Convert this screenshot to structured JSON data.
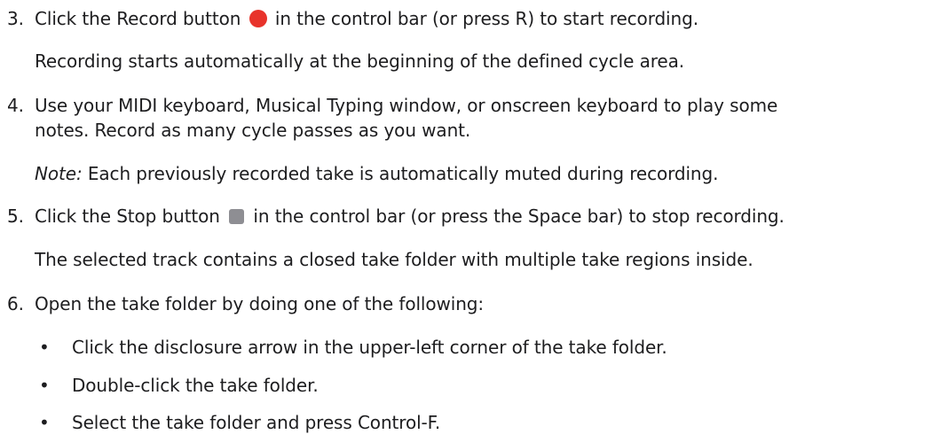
{
  "steps": [
    {
      "number": "3.",
      "text_before": "Click the Record button",
      "text_after": "in the control bar (or press R) to start recording.",
      "icon": "record-button-icon",
      "followup": "Recording starts automatically at the beginning of the defined cycle area."
    },
    {
      "number": "4.",
      "line1": "Use your MIDI keyboard, Musical Typing window, or onscreen keyboard to play some",
      "line2": "notes. Record as many cycle passes as you want.",
      "note_label": "Note:",
      "note_text": "Each previously recorded take is automatically muted during recording."
    },
    {
      "number": "5.",
      "text_before": "Click the Stop button",
      "text_after": "in the control bar (or press the Space bar) to stop recording.",
      "icon": "stop-button-icon",
      "followup": "The selected track contains a closed take folder with multiple take regions inside."
    },
    {
      "number": "6.",
      "text": "Open the take folder by doing one of the following:",
      "bullets": [
        "Click the disclosure arrow in the upper-left corner of the take folder.",
        "Double-click the take folder.",
        "Select the take folder and press Control-F."
      ]
    }
  ],
  "bullet_glyph": "•",
  "colors": {
    "record": "#e8332b",
    "stop": "#8e8e93",
    "text": "#1d1d1f"
  }
}
